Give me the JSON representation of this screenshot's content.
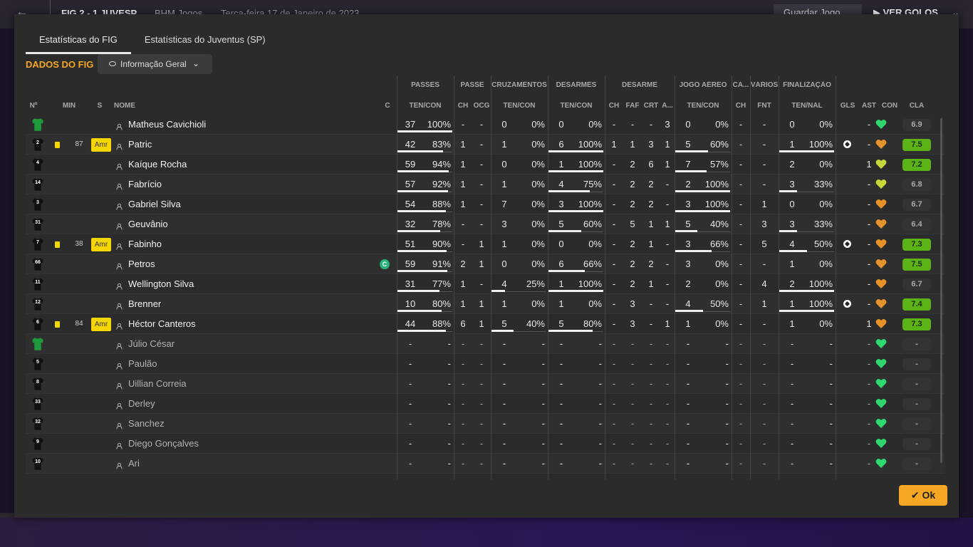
{
  "topbar": {
    "back_icon": "arrow-left-icon",
    "score": "FIG  2 - 1  JUVESP",
    "meta": "BHM Jogos",
    "date": "Terça-feira 17 de Janeiro de 2023",
    "save_label": "Guardar Jogo",
    "goals_label": "VER GOLOS"
  },
  "tabs": [
    {
      "label": "Estatísticas do FIG",
      "active": true
    },
    {
      "label": "Estatísticas do Juventus (SP)",
      "active": false
    }
  ],
  "section_title": "DADOS DO FIG",
  "view_dropdown": "Informação Geral",
  "group_headers": {
    "passes": "PASSES",
    "passe": "PASSE",
    "cruzamentos": "CRUZAMENTOS",
    "desarmes": "DESARMES",
    "desarme": "DESARME",
    "jogo_aereo": "JOGO AÉREO",
    "ca": "CA...",
    "varios": "VÁRIOS",
    "finalizacao": "FINALIZAÇÃO"
  },
  "columns": {
    "no": "Nº",
    "min": "MIN",
    "s": "S",
    "nome": "NOME",
    "c": "C",
    "passes": "TEN/CON",
    "passe_ch": "CH",
    "passe_ocg": "OCG",
    "cruz": "TEN/CON",
    "desarmes": "TEN/CON",
    "des_ch": "CH",
    "des_faf": "FAF",
    "des_crt": "CRT",
    "des_a": "A...",
    "aereo": "TEN/CON",
    "ca_ch": "CH",
    "varios_fnt": "FNT",
    "finalizacao": "TEN/NAL",
    "gls": "GLS",
    "ast": "AST",
    "con": "CON",
    "cla": "CLA"
  },
  "colors": {
    "accent": "#f5a623",
    "rating_green": "#5bb318",
    "yellow_card": "#f6d600"
  },
  "players": [
    {
      "num": "",
      "kit": "gk",
      "card": false,
      "min": "",
      "amr": "",
      "name": "Matheus Cavichioli",
      "captain": false,
      "passes": [
        "37",
        "100%"
      ],
      "passes_pct": 1.0,
      "passe_ch": "-",
      "passe_ocg": "-",
      "cruz": [
        "0",
        "0%"
      ],
      "cruz_pct": 0,
      "desarmes": [
        "0",
        "0%"
      ],
      "desarmes_pct": 0,
      "des_ch": "-",
      "des_faf": "-",
      "des_crt": "-",
      "des_a": "3",
      "aereo": [
        "0",
        "0%"
      ],
      "aereo_pct": 0,
      "ca_ch": "-",
      "fnt": "-",
      "final": [
        "0",
        "0%"
      ],
      "final_pct": 0,
      "gls": "",
      "ast": "-",
      "con": "green",
      "cla": "6.9",
      "cla_hi": false
    },
    {
      "num": "2",
      "kit": "out",
      "card": true,
      "min": "87",
      "amr": "Amr",
      "name": "Patric",
      "captain": false,
      "passes": [
        "42",
        "83%"
      ],
      "passes_pct": 0.83,
      "passe_ch": "1",
      "passe_ocg": "-",
      "cruz": [
        "1",
        "0%"
      ],
      "cruz_pct": 0,
      "desarmes": [
        "6",
        "100%"
      ],
      "desarmes_pct": 1.0,
      "des_ch": "1",
      "des_faf": "1",
      "des_crt": "3",
      "des_a": "1",
      "aereo": [
        "5",
        "60%"
      ],
      "aereo_pct": 0.6,
      "ca_ch": "-",
      "fnt": "-",
      "final": [
        "1",
        "100%"
      ],
      "final_pct": 1.0,
      "gls": "ball",
      "ast": "-",
      "con": "orange",
      "cla": "7.5",
      "cla_hi": true
    },
    {
      "num": "4",
      "kit": "out",
      "card": false,
      "min": "",
      "amr": "",
      "name": "Kaíque Rocha",
      "captain": false,
      "passes": [
        "59",
        "94%"
      ],
      "passes_pct": 0.94,
      "passe_ch": "1",
      "passe_ocg": "-",
      "cruz": [
        "0",
        "0%"
      ],
      "cruz_pct": 0,
      "desarmes": [
        "1",
        "100%"
      ],
      "desarmes_pct": 1.0,
      "des_ch": "-",
      "des_faf": "2",
      "des_crt": "6",
      "des_a": "1",
      "aereo": [
        "7",
        "57%"
      ],
      "aereo_pct": 0.57,
      "ca_ch": "-",
      "fnt": "-",
      "final": [
        "2",
        "0%"
      ],
      "final_pct": 0,
      "gls": "",
      "ast": "1",
      "con": "yellow",
      "cla": "7.2",
      "cla_hi": true
    },
    {
      "num": "14",
      "kit": "out",
      "card": false,
      "min": "",
      "amr": "",
      "name": "Fabrício",
      "captain": false,
      "passes": [
        "57",
        "92%"
      ],
      "passes_pct": 0.92,
      "passe_ch": "1",
      "passe_ocg": "-",
      "cruz": [
        "1",
        "0%"
      ],
      "cruz_pct": 0,
      "desarmes": [
        "4",
        "75%"
      ],
      "desarmes_pct": 0.75,
      "des_ch": "-",
      "des_faf": "2",
      "des_crt": "2",
      "des_a": "-",
      "aereo": [
        "2",
        "100%"
      ],
      "aereo_pct": 1.0,
      "ca_ch": "-",
      "fnt": "-",
      "final": [
        "3",
        "33%"
      ],
      "final_pct": 0.33,
      "gls": "",
      "ast": "-",
      "con": "yellow",
      "cla": "6.8",
      "cla_hi": false
    },
    {
      "num": "3",
      "kit": "out",
      "card": false,
      "min": "",
      "amr": "",
      "name": "Gabriel Silva",
      "captain": false,
      "passes": [
        "54",
        "88%"
      ],
      "passes_pct": 0.88,
      "passe_ch": "1",
      "passe_ocg": "-",
      "cruz": [
        "7",
        "0%"
      ],
      "cruz_pct": 0,
      "desarmes": [
        "3",
        "100%"
      ],
      "desarmes_pct": 1.0,
      "des_ch": "-",
      "des_faf": "2",
      "des_crt": "2",
      "des_a": "-",
      "aereo": [
        "3",
        "100%"
      ],
      "aereo_pct": 1.0,
      "ca_ch": "-",
      "fnt": "1",
      "final": [
        "0",
        "0%"
      ],
      "final_pct": 0,
      "gls": "",
      "ast": "-",
      "con": "orange",
      "cla": "6.7",
      "cla_hi": false
    },
    {
      "num": "31",
      "kit": "out",
      "card": false,
      "min": "",
      "amr": "",
      "name": "Geuvânio",
      "captain": false,
      "passes": [
        "32",
        "78%"
      ],
      "passes_pct": 0.78,
      "passe_ch": "-",
      "passe_ocg": "-",
      "cruz": [
        "3",
        "0%"
      ],
      "cruz_pct": 0,
      "desarmes": [
        "5",
        "60%"
      ],
      "desarmes_pct": 0.6,
      "des_ch": "-",
      "des_faf": "5",
      "des_crt": "1",
      "des_a": "1",
      "aereo": [
        "5",
        "40%"
      ],
      "aereo_pct": 0.4,
      "ca_ch": "-",
      "fnt": "3",
      "final": [
        "3",
        "33%"
      ],
      "final_pct": 0.33,
      "gls": "",
      "ast": "-",
      "con": "orange",
      "cla": "6.4",
      "cla_hi": false
    },
    {
      "num": "7",
      "kit": "out",
      "card": true,
      "min": "38",
      "amr": "Amr",
      "name": "Fabinho",
      "captain": false,
      "passes": [
        "51",
        "90%"
      ],
      "passes_pct": 0.9,
      "passe_ch": "-",
      "passe_ocg": "1",
      "cruz": [
        "1",
        "0%"
      ],
      "cruz_pct": 0,
      "desarmes": [
        "0",
        "0%"
      ],
      "desarmes_pct": 0,
      "des_ch": "-",
      "des_faf": "2",
      "des_crt": "1",
      "des_a": "-",
      "aereo": [
        "3",
        "66%"
      ],
      "aereo_pct": 0.66,
      "ca_ch": "-",
      "fnt": "5",
      "final": [
        "4",
        "50%"
      ],
      "final_pct": 0.5,
      "gls": "ball",
      "ast": "-",
      "con": "orange",
      "cla": "7.3",
      "cla_hi": true
    },
    {
      "num": "66",
      "kit": "out",
      "card": false,
      "min": "",
      "amr": "",
      "name": "Petros",
      "captain": true,
      "captain_label": "C",
      "passes": [
        "59",
        "91%"
      ],
      "passes_pct": 0.91,
      "passe_ch": "2",
      "passe_ocg": "1",
      "cruz": [
        "0",
        "0%"
      ],
      "cruz_pct": 0,
      "desarmes": [
        "6",
        "66%"
      ],
      "desarmes_pct": 0.66,
      "des_ch": "-",
      "des_faf": "2",
      "des_crt": "2",
      "des_a": "-",
      "aereo": [
        "3",
        "0%"
      ],
      "aereo_pct": 0,
      "ca_ch": "-",
      "fnt": "-",
      "final": [
        "1",
        "0%"
      ],
      "final_pct": 0,
      "gls": "",
      "ast": "-",
      "con": "orange",
      "cla": "7.5",
      "cla_hi": true
    },
    {
      "num": "11",
      "kit": "out",
      "card": false,
      "min": "",
      "amr": "",
      "name": "Wellington Silva",
      "captain": false,
      "passes": [
        "31",
        "77%"
      ],
      "passes_pct": 0.77,
      "passe_ch": "1",
      "passe_ocg": "-",
      "cruz": [
        "4",
        "25%"
      ],
      "cruz_pct": 0.25,
      "desarmes": [
        "1",
        "100%"
      ],
      "desarmes_pct": 1.0,
      "des_ch": "-",
      "des_faf": "2",
      "des_crt": "1",
      "des_a": "-",
      "aereo": [
        "2",
        "0%"
      ],
      "aereo_pct": 0,
      "ca_ch": "-",
      "fnt": "4",
      "final": [
        "2",
        "100%"
      ],
      "final_pct": 1.0,
      "gls": "",
      "ast": "-",
      "con": "orange",
      "cla": "6.7",
      "cla_hi": false
    },
    {
      "num": "12",
      "kit": "out",
      "card": false,
      "min": "",
      "amr": "",
      "name": "Brenner",
      "captain": false,
      "passes": [
        "10",
        "80%"
      ],
      "passes_pct": 0.8,
      "passe_ch": "1",
      "passe_ocg": "1",
      "cruz": [
        "1",
        "0%"
      ],
      "cruz_pct": 0,
      "desarmes": [
        "1",
        "0%"
      ],
      "desarmes_pct": 0,
      "des_ch": "-",
      "des_faf": "3",
      "des_crt": "-",
      "des_a": "-",
      "aereo": [
        "4",
        "50%"
      ],
      "aereo_pct": 0.5,
      "ca_ch": "-",
      "fnt": "1",
      "final": [
        "1",
        "100%"
      ],
      "final_pct": 1.0,
      "gls": "ball",
      "ast": "-",
      "con": "orange",
      "cla": "7.4",
      "cla_hi": true
    },
    {
      "num": "6",
      "kit": "out",
      "card": true,
      "min": "84",
      "amr": "Amr",
      "name": "Héctor Canteros",
      "captain": false,
      "passes": [
        "44",
        "88%"
      ],
      "passes_pct": 0.88,
      "passe_ch": "6",
      "passe_ocg": "1",
      "cruz": [
        "5",
        "40%"
      ],
      "cruz_pct": 0.4,
      "desarmes": [
        "5",
        "80%"
      ],
      "desarmes_pct": 0.8,
      "des_ch": "-",
      "des_faf": "3",
      "des_crt": "-",
      "des_a": "1",
      "aereo": [
        "1",
        "0%"
      ],
      "aereo_pct": 0,
      "ca_ch": "-",
      "fnt": "-",
      "final": [
        "1",
        "0%"
      ],
      "final_pct": 0,
      "gls": "",
      "ast": "1",
      "con": "orange",
      "cla": "7.3",
      "cla_hi": true
    },
    {
      "num": "",
      "kit": "gk",
      "unused": true,
      "name": "Júlio César"
    },
    {
      "num": "5",
      "kit": "out",
      "unused": true,
      "name": "Paulão"
    },
    {
      "num": "8",
      "kit": "out",
      "unused": true,
      "name": "Uillian Correia"
    },
    {
      "num": "33",
      "kit": "out",
      "unused": true,
      "name": "Derley"
    },
    {
      "num": "32",
      "kit": "out",
      "unused": true,
      "name": "Sanchez"
    },
    {
      "num": "9",
      "kit": "out",
      "unused": true,
      "name": "Diego Gonçalves"
    },
    {
      "num": "10",
      "kit": "out",
      "unused": true,
      "name": "Ari"
    }
  ],
  "ok_label": "Ok"
}
